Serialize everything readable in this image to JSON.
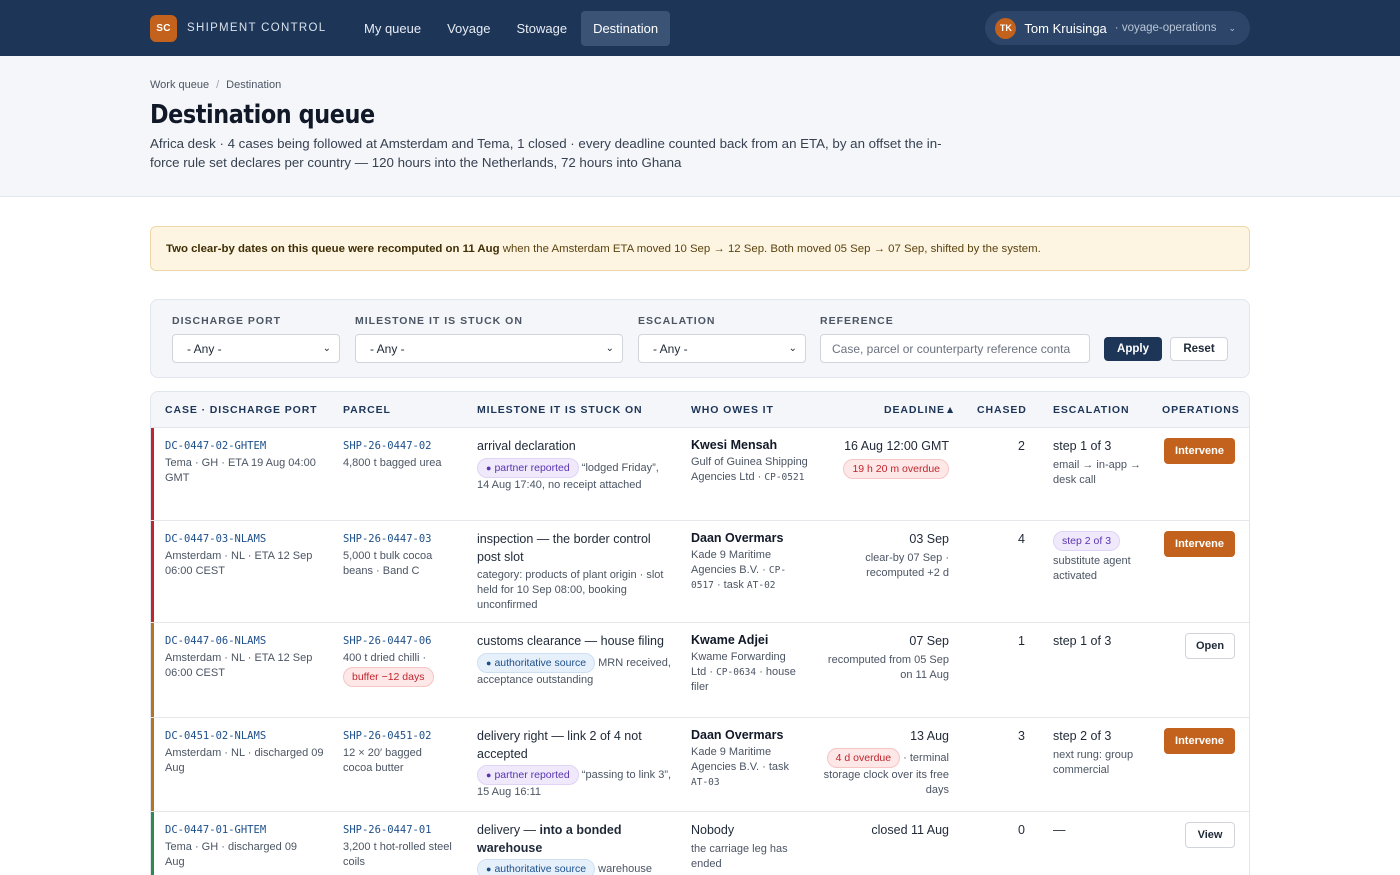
{
  "app": {
    "logo": "SC",
    "name": "SHIPMENT CONTROL",
    "nav": [
      {
        "label": "My queue"
      },
      {
        "label": "Voyage"
      },
      {
        "label": "Stowage"
      },
      {
        "label": "Destination"
      }
    ],
    "user": {
      "initials": "TK",
      "name": "Tom Kruisinga",
      "role": "· voyage-operations"
    }
  },
  "header": {
    "breadcrumb": [
      "Work queue",
      "Destination"
    ],
    "title": "Destination queue",
    "subtitle": "Africa desk · 4 cases being followed at Amsterdam and Tema, 1 closed · every deadline counted back from an ETA, by an offset the in-force rule set declares per country — 120 hours into the Netherlands, 72 hours into Ghana"
  },
  "alert": {
    "lead": "Two clear-by dates on this queue were recomputed on 11 Aug",
    "pre_link": "when the",
    "link": "Amsterdam ETA",
    "rest": "moved 10 Sep → 12 Sep. Both moved 05 Sep → 07 Sep, shifted by the system."
  },
  "filters": {
    "discharge_port": {
      "label": "DISCHARGE PORT",
      "value": "- Any -"
    },
    "milestone": {
      "label": "MILESTONE IT IS STUCK ON",
      "value": "- Any -"
    },
    "escalation": {
      "label": "ESCALATION",
      "value": "- Any -"
    },
    "reference": {
      "label": "REFERENCE",
      "placeholder": "Case, parcel or counterparty reference conta"
    },
    "apply": "Apply",
    "reset": "Reset"
  },
  "table": {
    "columns": {
      "case": "CASE · DISCHARGE PORT",
      "parcel": "PARCEL",
      "milestone": "MILESTONE IT IS STUCK ON",
      "who": "WHO OWES IT",
      "deadline": "DEADLINE",
      "sort_indicator": "▲",
      "chased": "CHASED",
      "escalation": "ESCALATION",
      "operations": "OPERATIONS"
    },
    "rows": [
      {
        "bar_color": "#c0262d",
        "case_id": "DC-0447-02-GHTEM",
        "case_sub": "Tema · GH · ETA 19 Aug 04:00 GMT",
        "parcel_id": "SHP-26-0447-02",
        "parcel_sub": "4,800 t bagged urea",
        "milestone_title": "arrival declaration",
        "source_pill": "partner reported",
        "milestone_note": "“lodged Friday”, 14 Aug 17:40, no receipt attached",
        "who_name": "Kwesi Mensah",
        "who_org": "Gulf of Guinea Shipping Agencies Ltd ·",
        "who_ref": "CP-0521",
        "deadline": "16 Aug 12:00 GMT",
        "deadline_pill": "19 h 20 m overdue",
        "chased": "2",
        "escalation": "step 1 of 3",
        "escalation_sub": "email → in-app → desk call",
        "action": "Intervene"
      },
      {
        "bar_color": "#c0262d",
        "case_id": "DC-0447-03-NLAMS",
        "case_sub": "Amsterdam · NL · ETA 12 Sep 06:00 CEST",
        "parcel_id": "SHP-26-0447-03",
        "parcel_sub": "5,000 t bulk cocoa beans · Band C",
        "milestone_title": "inspection — the border control post slot",
        "milestone_note": "category: products of plant origin · slot held for 10 Sep 08:00, booking unconfirmed",
        "who_name": "Daan Overmars",
        "who_org": "Kade 9 Maritime Agencies B.V. ·",
        "who_ref": "CP-0517",
        "who_task": "· task",
        "who_task_ref": "AT-02",
        "deadline": "03 Sep",
        "deadline_note": "clear-by 07 Sep · recomputed +2 d",
        "chased": "4",
        "escalation_pill": "step 2 of 3",
        "escalation_sub": "substitute agent activated",
        "action": "Intervene"
      },
      {
        "bar_color": "#b5751f",
        "case_id": "DC-0447-06-NLAMS",
        "case_sub": "Amsterdam · NL · ETA 12 Sep 06:00 CEST",
        "parcel_id": "SHP-26-0447-06",
        "parcel_sub": "400 t dried chilli ·",
        "parcel_pill": "buffer −12 days",
        "milestone_title": "customs clearance — house filing",
        "source_pill": "authoritative source",
        "milestone_note": "MRN received, acceptance outstanding",
        "who_name": "Kwame Adjei",
        "who_org": "Kwame Forwarding Ltd ·",
        "who_ref": "CP-0634",
        "who_tail": "· house filer",
        "deadline": "07 Sep",
        "deadline_note": "recomputed from 05 Sep on 11 Aug",
        "chased": "1",
        "escalation": "step 1 of 3",
        "action": "Open"
      },
      {
        "bar_color": "#b5751f",
        "case_id": "DC-0451-02-NLAMS",
        "case_sub": "Amsterdam · NL · discharged 09 Aug",
        "parcel_id": "SHP-26-0451-02",
        "parcel_sub": "12 × 20′ bagged cocoa butter",
        "milestone_title": "delivery right — link 2 of 4 not accepted",
        "source_pill": "partner reported",
        "milestone_note": "“passing to link 3”, 15 Aug 16:11",
        "who_name": "Daan Overmars",
        "who_org": "Kade 9 Maritime Agencies B.V. · task",
        "who_ref": "AT-03",
        "deadline": "13 Aug",
        "deadline_pill": "4 d overdue",
        "deadline_note": "· terminal storage clock over its free days",
        "chased": "3",
        "escalation": "step 2 of 3",
        "escalation_sub": "next rung: group commercial",
        "action": "Intervene"
      },
      {
        "bar_color": "#2f8a4f",
        "case_id": "DC-0447-01-GHTEM",
        "case_sub": "Tema · GH · discharged 09 Aug",
        "parcel_id": "SHP-26-0447-01",
        "parcel_sub": "3,200 t hot-rolled steel coils",
        "milestone_pre": "delivery —",
        "milestone_bold": "into a bonded warehouse",
        "source_pill": "authoritative source",
        "milestone_note": "warehouse",
        "who_name": "Nobody",
        "who_org": "the carriage leg has ended",
        "deadline": "closed 11 Aug",
        "chased": "0",
        "escalation": "—",
        "action": "View"
      }
    ]
  }
}
